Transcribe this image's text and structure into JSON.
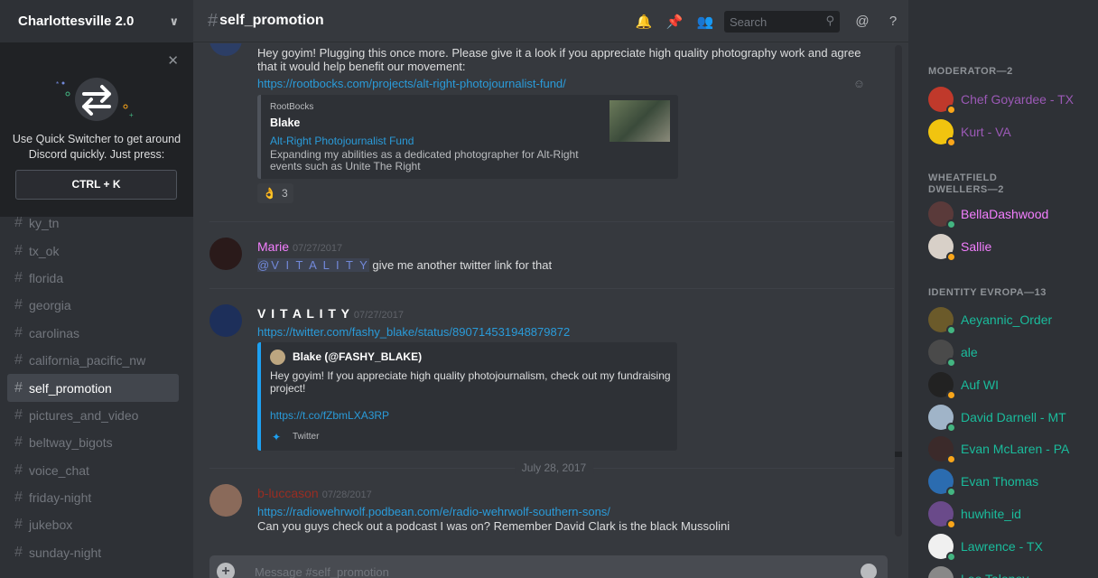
{
  "server": {
    "name": "Charlottesville 2.0"
  },
  "quick_switcher": {
    "text_line1": "Use Quick Switcher to get around",
    "text_line2": "Discord quickly. Just press:",
    "shortcut": "CTRL + K"
  },
  "channels": [
    {
      "name": "ky_tn",
      "active": false
    },
    {
      "name": "tx_ok",
      "active": false
    },
    {
      "name": "florida",
      "active": false
    },
    {
      "name": "georgia",
      "active": false
    },
    {
      "name": "carolinas",
      "active": false
    },
    {
      "name": "california_pacific_nw",
      "active": false
    },
    {
      "name": "self_promotion",
      "active": true
    },
    {
      "name": "pictures_and_video",
      "active": false
    },
    {
      "name": "beltway_bigots",
      "active": false
    },
    {
      "name": "voice_chat",
      "active": false
    },
    {
      "name": "friday-night",
      "active": false
    },
    {
      "name": "jukebox",
      "active": false
    },
    {
      "name": "sunday-night",
      "active": false
    }
  ],
  "header": {
    "hash": "#",
    "channel": "self_promotion",
    "search_placeholder": "Search"
  },
  "messages": {
    "m1": {
      "line1": "Hey goyim! Plugging this once more. Please give it a look if you appreciate high quality photography work and agree",
      "line2": "that it would help benefit our movement:",
      "link": "https://rootbocks.com/projects/alt-right-photojournalist-fund/",
      "embed": {
        "provider": "RootBocks",
        "author": "Blake",
        "title": "Alt-Right Photojournalist Fund",
        "desc1": "Expanding my abilities as a dedicated photographer for Alt-Right",
        "desc2": "events such as Unite The Right"
      },
      "reaction": {
        "emoji": "👌",
        "count": "3"
      }
    },
    "m2": {
      "author": "Marie",
      "author_color": "#f47fff",
      "time": "07/27/2017",
      "mention": "@V I T A L I T Y",
      "text": "give me another twitter link for that"
    },
    "m3": {
      "author": "V I T A L I T Y",
      "author_color": "#ffffff",
      "time": "07/27/2017",
      "link": "https://twitter.com/fashy_blake/status/890714531948879872",
      "embed": {
        "author": "Blake (@FASHY_BLAKE)",
        "text1": "Hey goyim! If you appreciate high quality photojournalism, check out my fundraising",
        "text2": "project!",
        "link": "https://t.co/fZbmLXA3RP",
        "footer": "Twitter"
      }
    },
    "date_divider": "July 28, 2017",
    "m4": {
      "author": "b-luccason",
      "author_color": "#992d22",
      "time": "07/28/2017",
      "link": "https://radiowehrwolf.podbean.com/e/radio-wehrwolf-southern-sons/",
      "text": "Can you guys check out a podcast I was on? Remember David Clark is the black Mussolini"
    }
  },
  "composer": {
    "placeholder": "Message #self_promotion"
  },
  "member_groups": [
    {
      "title": "MODERATOR—2",
      "members": [
        {
          "name": "Chef Goyardee - TX",
          "color": "#9b59b6",
          "status": "#faa61a",
          "avatar": "#c0392b"
        },
        {
          "name": "Kurt - VA",
          "color": "#9b59b6",
          "status": "#faa61a",
          "avatar": "#f1c40f"
        }
      ]
    },
    {
      "title_line1": "WHEATFIELD",
      "title_line2": "DWELLERS—2",
      "members": [
        {
          "name": "BellaDashwood",
          "color": "#f47fff",
          "status": "#43b581",
          "avatar": "#5a3a3a"
        },
        {
          "name": "Sallie",
          "color": "#f47fff",
          "status": "#faa61a",
          "avatar": "#d8d0c8"
        }
      ]
    },
    {
      "title": "IDENTITY EVROPA—13",
      "members": [
        {
          "name": "Aeyannic_Order",
          "color": "#1abc9c",
          "status": "#43b581",
          "avatar": "#6b5a2a"
        },
        {
          "name": "ale",
          "color": "#1abc9c",
          "status": "#43b581",
          "avatar": "#4a4a4a"
        },
        {
          "name": "Auf WI",
          "color": "#1abc9c",
          "status": "#faa61a",
          "avatar": "#222222"
        },
        {
          "name": "David Darnell - MT",
          "color": "#1abc9c",
          "status": "#43b581",
          "avatar": "#a0b4c8"
        },
        {
          "name": "Evan McLaren - PA",
          "color": "#1abc9c",
          "status": "#faa61a",
          "avatar": "#3b2a2a"
        },
        {
          "name": "Evan Thomas",
          "color": "#1abc9c",
          "status": "#43b581",
          "avatar": "#2b6cb0"
        },
        {
          "name": "huwhite_id",
          "color": "#1abc9c",
          "status": "#faa61a",
          "avatar": "#6a4a8a"
        },
        {
          "name": "Lawrence - TX",
          "color": "#1abc9c",
          "status": "#43b581",
          "avatar": "#f0f0f0"
        },
        {
          "name": "Leo Taloney",
          "color": "#1abc9c",
          "status": "#43b581",
          "avatar": "#888888"
        }
      ]
    }
  ]
}
